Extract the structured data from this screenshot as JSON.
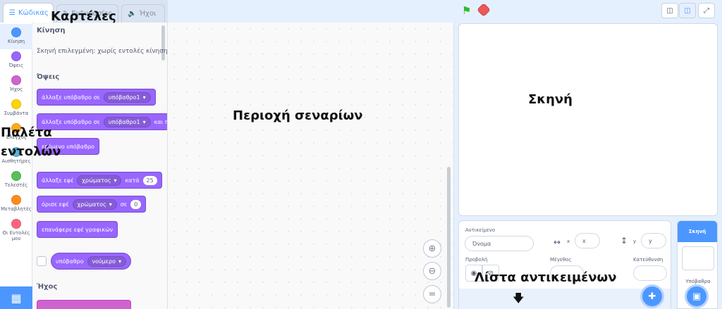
{
  "tabs": [
    {
      "label": "Κώδικας",
      "icon": "code-icon"
    },
    {
      "label": "Ενδυμασίες",
      "icon": "costume-icon"
    },
    {
      "label": "Ήχοι",
      "icon": "speaker-icon"
    }
  ],
  "categories": [
    {
      "label": "Κίνηση",
      "color": "#4c97ff"
    },
    {
      "label": "Όψεις",
      "color": "#9966ff"
    },
    {
      "label": "Ήχος",
      "color": "#cf63cf"
    },
    {
      "label": "Συμβάντα",
      "color": "#ffd500"
    },
    {
      "label": "Έλεγχος",
      "color": "#ffab19"
    },
    {
      "label": "Αισθητήρες",
      "color": "#5cb1d6"
    },
    {
      "label": "Τελεστές",
      "color": "#59c059"
    },
    {
      "label": "Μεταβλητές",
      "color": "#ff8c1a"
    },
    {
      "label": "Οι Εντολές μου",
      "color": "#ff6680"
    }
  ],
  "palette": {
    "motion_header": "Κίνηση",
    "motion_note": "Σκηνή επιλεγμένη: χωρίς εντολές κίνησης",
    "looks_header": "Όψεις",
    "sound_header": "Ήχος",
    "blocks": {
      "switch_backdrop": {
        "text": "άλλαξε υπόβαθρο σε",
        "value": "υπόβαθρο1"
      },
      "switch_backdrop_wait": {
        "text": "άλλαξε υπόβαθρο σε",
        "value": "υπόβαθρο1",
        "suffix": "και περίμενε"
      },
      "next_backdrop": {
        "text": "επόμενο υπόβαθρο"
      },
      "change_effect": {
        "text": "άλλαξε εφέ",
        "value": "χρώματος",
        "by": "κατά",
        "number": "25"
      },
      "set_effect": {
        "text": "όρισε εφέ",
        "value": "χρώματος",
        "to": "σε",
        "number": "0"
      },
      "clear_effects": {
        "text": "επανάφερε εφέ γραφικών"
      },
      "backdrop_reporter": {
        "text": "υπόβαθρο",
        "value": "νούμερο"
      }
    }
  },
  "sprite_info": {
    "sprite_label": "Αντικείμενο",
    "name_placeholder": "Όνομα",
    "x_label": "x",
    "x_value": "x",
    "y_label": "y",
    "y_value": "y",
    "show_label": "Προβολή",
    "size_label": "Μέγεθος",
    "direction_label": "Κατεύθυνση"
  },
  "stage_selector": {
    "header": "Σκηνή",
    "backdrops_label": "Υπόβαθρα"
  },
  "annotations": {
    "tabs": "Καρτέλες",
    "palette": "Παλέτα εντολών",
    "scripts": "Περιοχή σεναρίων",
    "stage": "Σκηνή",
    "sprites": "Λίστα αντικειμένων"
  }
}
